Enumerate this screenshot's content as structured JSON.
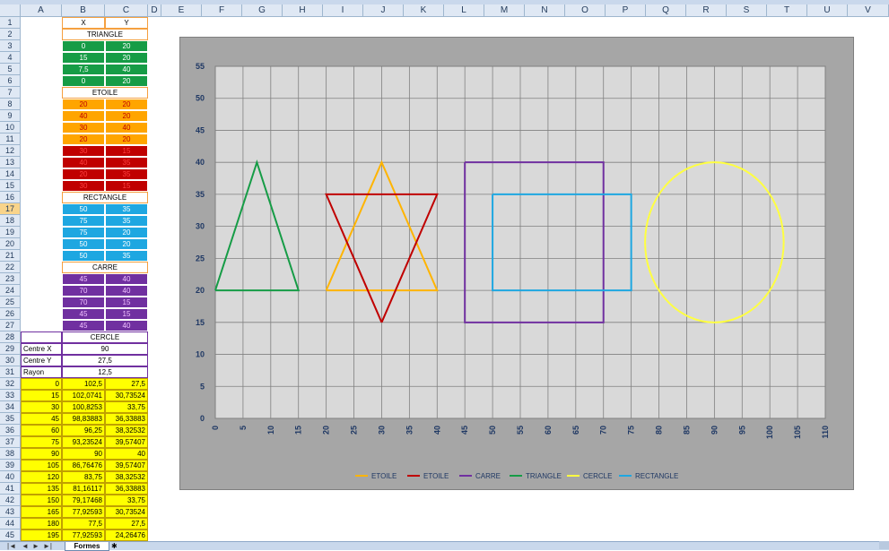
{
  "columns": [
    "A",
    "B",
    "C",
    "D",
    "E",
    "F",
    "G",
    "H",
    "I",
    "J",
    "K",
    "L",
    "M",
    "N",
    "O",
    "P",
    "Q",
    "R",
    "S",
    "T",
    "U",
    "V"
  ],
  "active_row": 17,
  "colors": {
    "green": "#169c46",
    "orange": "#ffa500",
    "red": "#c00000",
    "blue": "#1ea7e1",
    "purple": "#7030a0",
    "yellow": "#ffff00",
    "header_border": "#f5a040",
    "cercle_border": "#7030a0"
  },
  "rows": [
    {
      "n": 1,
      "A": "",
      "B": "X",
      "C": "Y",
      "style": "header"
    },
    {
      "n": 2,
      "A": "",
      "B": "TRIANGLE",
      "merge": true,
      "style": "header"
    },
    {
      "n": 3,
      "A": "",
      "B": "0",
      "C": "20",
      "style": "green"
    },
    {
      "n": 4,
      "A": "",
      "B": "15",
      "C": "20",
      "style": "green"
    },
    {
      "n": 5,
      "A": "",
      "B": "7,5",
      "C": "40",
      "style": "green"
    },
    {
      "n": 6,
      "A": "",
      "B": "0",
      "C": "20",
      "style": "green"
    },
    {
      "n": 7,
      "A": "",
      "B": "ETOILE",
      "merge": true,
      "style": "header"
    },
    {
      "n": 8,
      "A": "",
      "B": "20",
      "C": "20",
      "style": "orange"
    },
    {
      "n": 9,
      "A": "",
      "B": "40",
      "C": "20",
      "style": "orange"
    },
    {
      "n": 10,
      "A": "",
      "B": "30",
      "C": "40",
      "style": "orange"
    },
    {
      "n": 11,
      "A": "",
      "B": "20",
      "C": "20",
      "style": "orange"
    },
    {
      "n": 12,
      "A": "",
      "B": "30",
      "C": "15",
      "style": "red"
    },
    {
      "n": 13,
      "A": "",
      "B": "40",
      "C": "35",
      "style": "red"
    },
    {
      "n": 14,
      "A": "",
      "B": "20",
      "C": "35",
      "style": "red"
    },
    {
      "n": 15,
      "A": "",
      "B": "30",
      "C": "15",
      "style": "red"
    },
    {
      "n": 16,
      "A": "",
      "B": "RECTANGLE",
      "merge": true,
      "style": "header"
    },
    {
      "n": 17,
      "A": "",
      "B": "50",
      "C": "35",
      "style": "blue"
    },
    {
      "n": 18,
      "A": "",
      "B": "75",
      "C": "35",
      "style": "blue"
    },
    {
      "n": 19,
      "A": "",
      "B": "75",
      "C": "20",
      "style": "blue"
    },
    {
      "n": 20,
      "A": "",
      "B": "50",
      "C": "20",
      "style": "blue"
    },
    {
      "n": 21,
      "A": "",
      "B": "50",
      "C": "35",
      "style": "blue"
    },
    {
      "n": 22,
      "A": "",
      "B": "CARRE",
      "merge": true,
      "style": "header"
    },
    {
      "n": 23,
      "A": "",
      "B": "45",
      "C": "40",
      "style": "purple"
    },
    {
      "n": 24,
      "A": "",
      "B": "70",
      "C": "40",
      "style": "purple"
    },
    {
      "n": 25,
      "A": "",
      "B": "70",
      "C": "15",
      "style": "purple"
    },
    {
      "n": 26,
      "A": "",
      "B": "45",
      "C": "15",
      "style": "purple"
    },
    {
      "n": 27,
      "A": "",
      "B": "45",
      "C": "40",
      "style": "purple"
    },
    {
      "n": 28,
      "A": "",
      "B": "CERCLE",
      "merge": true,
      "style": "cercle"
    },
    {
      "n": 29,
      "A": "Centre X",
      "B": "90",
      "merge": true,
      "style": "param"
    },
    {
      "n": 30,
      "A": "Centre Y",
      "B": "27,5",
      "merge": true,
      "style": "param"
    },
    {
      "n": 31,
      "A": "Rayon",
      "B": "12,5",
      "merge": true,
      "style": "param"
    },
    {
      "n": 32,
      "A": "0",
      "B": "102,5",
      "C": "27,5",
      "style": "yellow"
    },
    {
      "n": 33,
      "A": "15",
      "B": "102,0741",
      "C": "30,73524",
      "style": "yellow"
    },
    {
      "n": 34,
      "A": "30",
      "B": "100,8253",
      "C": "33,75",
      "style": "yellow"
    },
    {
      "n": 35,
      "A": "45",
      "B": "98,83883",
      "C": "36,33883",
      "style": "yellow"
    },
    {
      "n": 36,
      "A": "60",
      "B": "96,25",
      "C": "38,32532",
      "style": "yellow"
    },
    {
      "n": 37,
      "A": "75",
      "B": "93,23524",
      "C": "39,57407",
      "style": "yellow"
    },
    {
      "n": 38,
      "A": "90",
      "B": "90",
      "C": "40",
      "style": "yellow"
    },
    {
      "n": 39,
      "A": "105",
      "B": "86,76476",
      "C": "39,57407",
      "style": "yellow"
    },
    {
      "n": 40,
      "A": "120",
      "B": "83,75",
      "C": "38,32532",
      "style": "yellow"
    },
    {
      "n": 41,
      "A": "135",
      "B": "81,16117",
      "C": "36,33883",
      "style": "yellow"
    },
    {
      "n": 42,
      "A": "150",
      "B": "79,17468",
      "C": "33,75",
      "style": "yellow"
    },
    {
      "n": 43,
      "A": "165",
      "B": "77,92593",
      "C": "30,73524",
      "style": "yellow"
    },
    {
      "n": 44,
      "A": "180",
      "B": "77,5",
      "C": "27,5",
      "style": "yellow"
    },
    {
      "n": 45,
      "A": "195",
      "B": "77,92593",
      "C": "24,26476",
      "style": "yellow"
    }
  ],
  "chart_data": {
    "type": "scatter",
    "title": "",
    "xlabel": "",
    "ylabel": "",
    "xlim": [
      0,
      110
    ],
    "ylim": [
      0,
      55
    ],
    "xticks": [
      "0",
      "5",
      "10",
      "15",
      "20",
      "25",
      "30",
      "35",
      "40",
      "45",
      "50",
      "55",
      "60",
      "65",
      "70",
      "75",
      "80",
      "85",
      "90",
      "95",
      "100",
      "105",
      "110"
    ],
    "yticks": [
      "0",
      "5",
      "10",
      "15",
      "20",
      "25",
      "30",
      "35",
      "40",
      "45",
      "50",
      "55"
    ],
    "grid": true,
    "legend_position": "bottom",
    "series": [
      {
        "name": "ETOILE",
        "color": "#ffb400",
        "points": [
          [
            20,
            20
          ],
          [
            40,
            20
          ],
          [
            30,
            40
          ],
          [
            20,
            20
          ]
        ]
      },
      {
        "name": "ETOILE",
        "color": "#c00000",
        "points": [
          [
            30,
            15
          ],
          [
            40,
            35
          ],
          [
            20,
            35
          ],
          [
            30,
            15
          ]
        ]
      },
      {
        "name": "CARRE",
        "color": "#7030a0",
        "points": [
          [
            45,
            40
          ],
          [
            70,
            40
          ],
          [
            70,
            15
          ],
          [
            45,
            15
          ],
          [
            45,
            40
          ]
        ]
      },
      {
        "name": "TRIANGLE",
        "color": "#169c46",
        "points": [
          [
            0,
            20
          ],
          [
            15,
            20
          ],
          [
            7.5,
            40
          ],
          [
            0,
            20
          ]
        ]
      },
      {
        "name": "CERCLE",
        "color": "#ffff40",
        "circle": {
          "cx": 90,
          "cy": 27.5,
          "r": 12.5
        }
      },
      {
        "name": "RECTANGLE",
        "color": "#1ea7e1",
        "points": [
          [
            50,
            35
          ],
          [
            75,
            35
          ],
          [
            75,
            20
          ],
          [
            50,
            20
          ],
          [
            50,
            35
          ]
        ]
      }
    ]
  },
  "tabs": {
    "sheet": "Formes",
    "nav": [
      "|◄",
      "◄",
      "►",
      "►|"
    ]
  }
}
